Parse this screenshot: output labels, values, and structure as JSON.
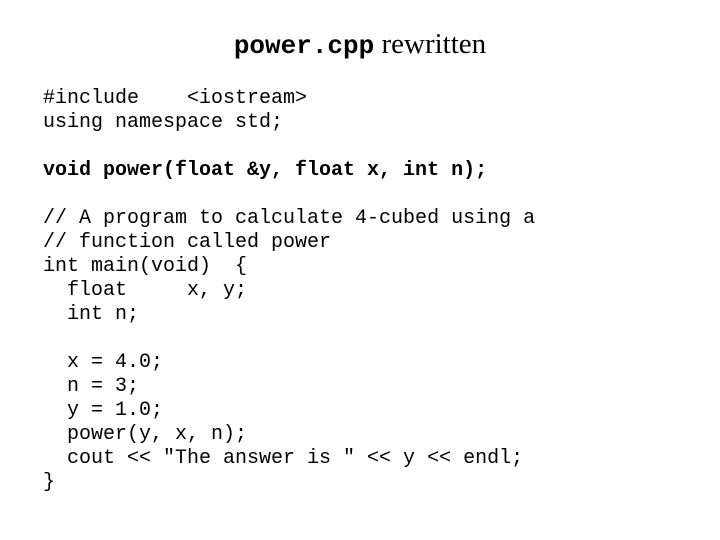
{
  "title": {
    "code_part": "power.cpp",
    "text_part": " rewritten"
  },
  "code_lines": [
    {
      "text": "#include    <iostream>",
      "bold": false
    },
    {
      "text": "using namespace std;",
      "bold": false
    },
    {
      "text": "",
      "bold": false
    },
    {
      "text": "void power(float &y, float x, int n);",
      "bold": true
    },
    {
      "text": "",
      "bold": false
    },
    {
      "text": "// A program to calculate 4-cubed using a",
      "bold": false
    },
    {
      "text": "// function called power",
      "bold": false
    },
    {
      "text": "int main(void)  {",
      "bold": false
    },
    {
      "text": "  float     x, y;",
      "bold": false
    },
    {
      "text": "  int n;",
      "bold": false
    },
    {
      "text": "",
      "bold": false
    },
    {
      "text": "  x = 4.0;",
      "bold": false
    },
    {
      "text": "  n = 3;",
      "bold": false
    },
    {
      "text": "  y = 1.0;",
      "bold": false
    },
    {
      "text": "  power(y, x, n);",
      "bold": false
    },
    {
      "text": "  cout << \"The answer is \" << y << endl;",
      "bold": false
    },
    {
      "text": "}",
      "bold": false
    }
  ]
}
